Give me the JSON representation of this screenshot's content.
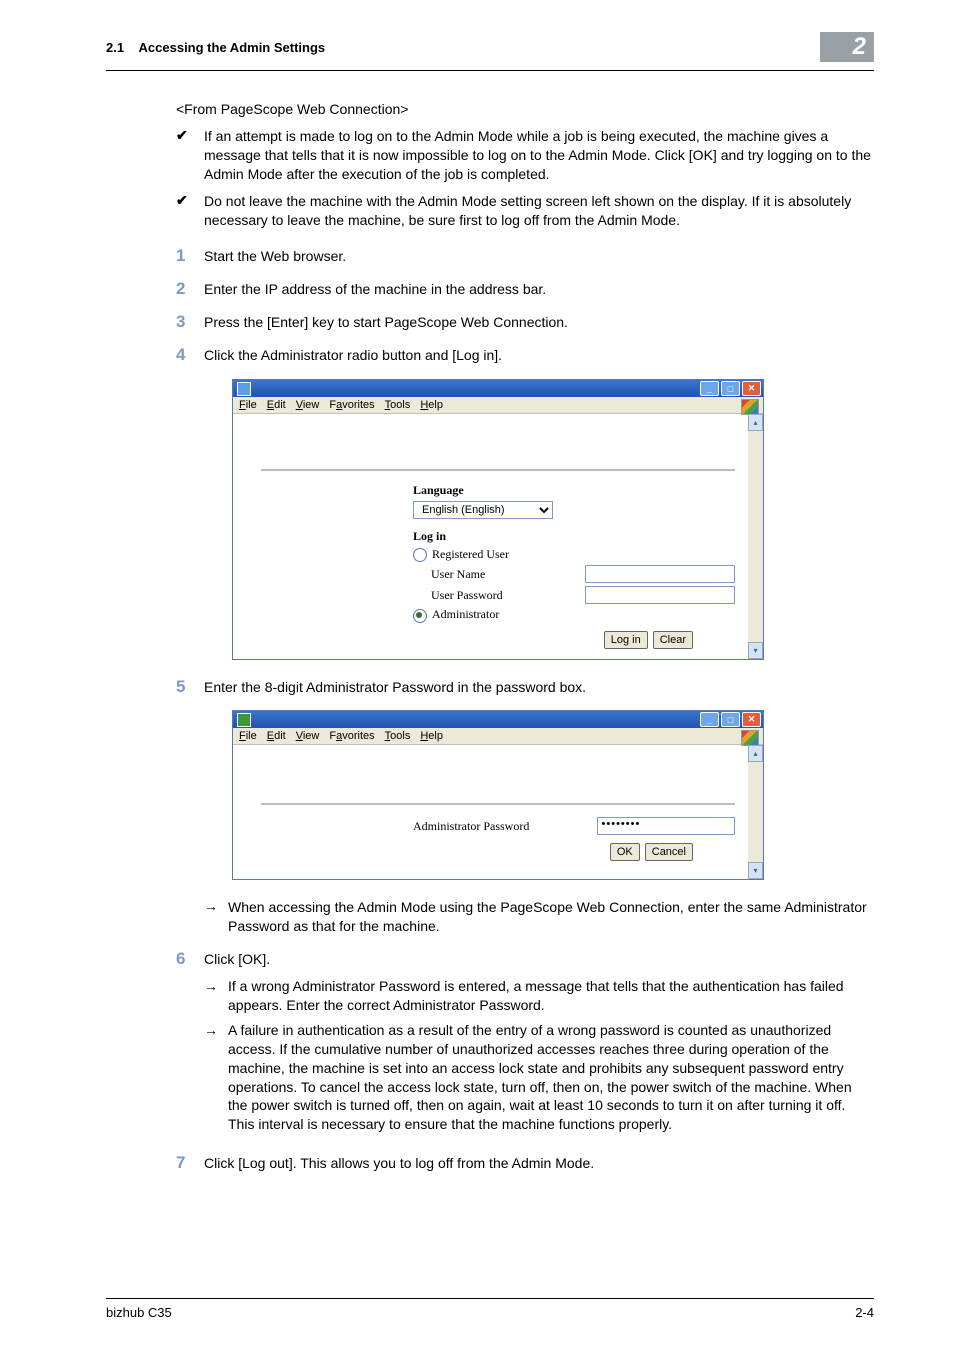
{
  "header": {
    "section_number": "2.1",
    "section_title": "Accessing the Admin Settings",
    "chapter_number": "2"
  },
  "intro": "<From PageScope Web Connection>",
  "bullets": [
    "If an attempt is made to log on to the Admin Mode while a job is being executed, the machine gives a message that tells that it is now impossible to log on to the Admin Mode. Click [OK] and try logging on to the Admin Mode after the execution of the job is completed.",
    "Do not leave the machine with the Admin Mode setting screen left shown on the display. If it is absolutely necessary to leave the machine, be sure first to log off from the Admin Mode."
  ],
  "steps": {
    "s1": "Start the Web browser.",
    "s2": "Enter the IP address of the machine in the address bar.",
    "s3": "Press the [Enter] key to start PageScope Web Connection.",
    "s4": "Click the Administrator radio button and [Log in].",
    "s5": "Enter the 8-digit Administrator Password in the password box.",
    "s5_note": "When accessing the Admin Mode using the PageScope Web Connection, enter the same Administrator Password as that for the machine.",
    "s6": "Click [OK].",
    "s6_notes": [
      "If a wrong Administrator Password is entered, a message that tells that the authentication has failed appears. Enter the correct Administrator Password.",
      "A failure in authentication as a result of the entry of a wrong password is counted as unauthorized access. If the cumulative number of unauthorized accesses reaches three during operation of the machine, the machine is set into an access lock state and prohibits any subsequent password entry operations. To cancel the access lock state, turn off, then on, the power switch of the machine. When the power switch is turned off, then on again, wait at least 10 seconds to turn it on after turning it off. This interval is necessary to ensure that the machine functions properly."
    ],
    "s7": "Click [Log out]. This allows you to log off from the Admin Mode."
  },
  "browser1": {
    "menu": {
      "file": "File",
      "edit": "Edit",
      "view": "View",
      "favorites": "Favorites",
      "tools": "Tools",
      "help": "Help"
    },
    "lang_label": "Language",
    "lang_value": "English (English)",
    "login_label": "Log in",
    "registered_user": "Registered User",
    "user_name": "User Name",
    "user_password": "User Password",
    "administrator": "Administrator",
    "btn_login": "Log in",
    "btn_clear": "Clear"
  },
  "browser2": {
    "menu": {
      "file": "File",
      "edit": "Edit",
      "view": "View",
      "favorites": "Favorites",
      "tools": "Tools",
      "help": "Help"
    },
    "admin_pw_label": "Administrator Password",
    "admin_pw_value": "••••••••",
    "btn_ok": "OK",
    "btn_cancel": "Cancel"
  },
  "footer": {
    "left": "bizhub C35",
    "right": "2-4"
  }
}
